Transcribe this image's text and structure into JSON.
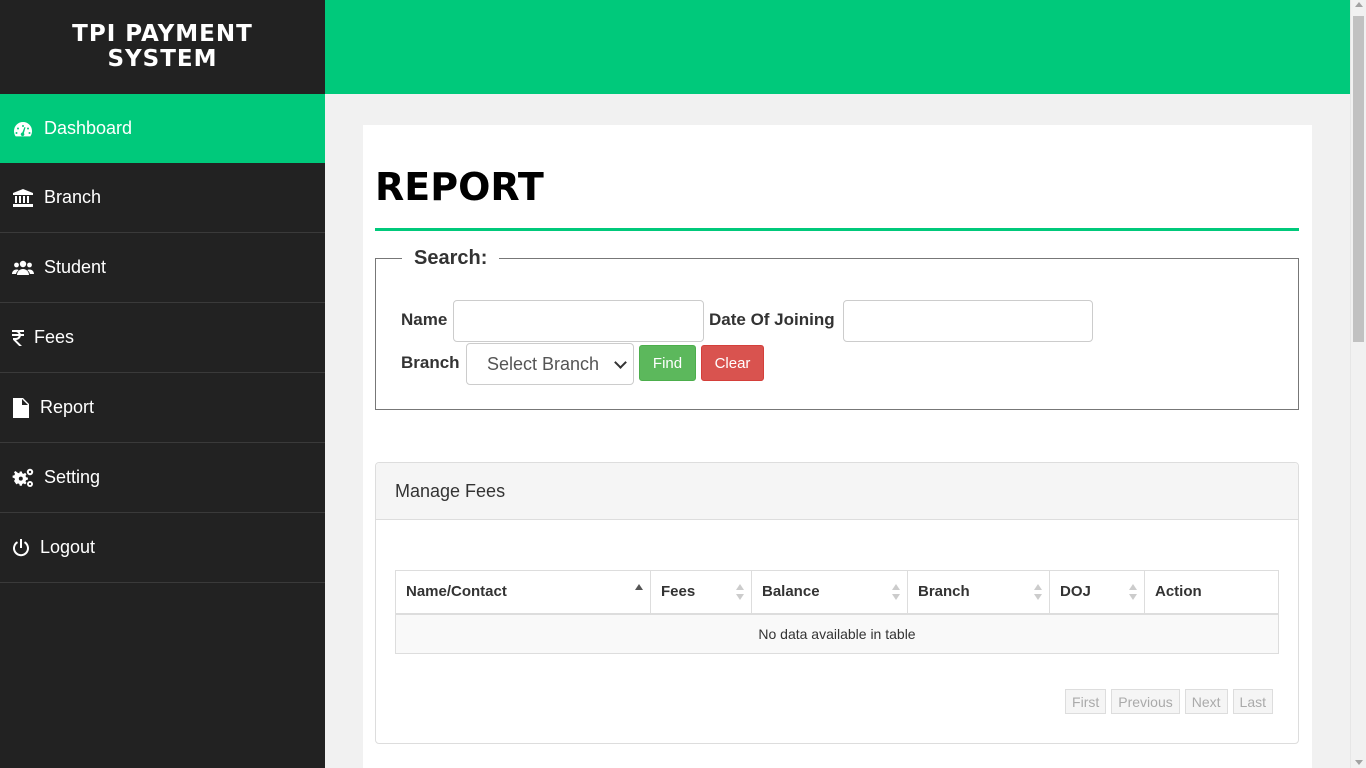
{
  "app": {
    "title": "TPI PAYMENT SYSTEM"
  },
  "sidebar": {
    "items": [
      {
        "label": "Dashboard",
        "icon": "dashboard-icon",
        "active": true
      },
      {
        "label": "Branch",
        "icon": "bank-icon"
      },
      {
        "label": "Student",
        "icon": "users-icon"
      },
      {
        "label": "Fees",
        "icon": "rupee-icon"
      },
      {
        "label": "Report",
        "icon": "document-icon"
      },
      {
        "label": "Setting",
        "icon": "gears-icon"
      },
      {
        "label": "Logout",
        "icon": "power-icon"
      }
    ]
  },
  "colors": {
    "accent": "#00c97b",
    "sidebar_bg": "#222222",
    "find": "#5cb85c",
    "clear": "#d9534f"
  },
  "page": {
    "title": "REPORT"
  },
  "search": {
    "legend": "Search:",
    "name_label": "Name",
    "name_value": "",
    "doj_label": "Date Of Joining",
    "doj_value": "",
    "branch_label": "Branch",
    "branch_selected": "Select Branch",
    "find_label": "Find",
    "clear_label": "Clear"
  },
  "table_card": {
    "title": "Manage Fees",
    "columns": [
      "Name/Contact",
      "Fees",
      "Balance",
      "Branch",
      "DOJ",
      "Action"
    ],
    "empty_message": "No data available in table",
    "pagination": [
      "First",
      "Previous",
      "Next",
      "Last"
    ]
  }
}
